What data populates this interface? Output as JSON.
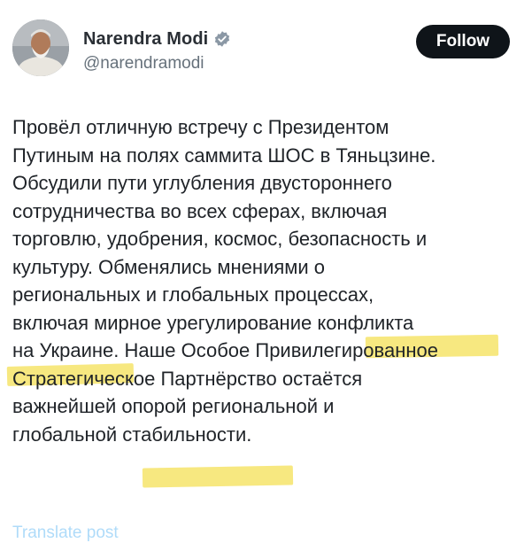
{
  "user": {
    "display_name": "Narendra Modi",
    "handle": "@narendramodi",
    "verified_color": "#8b98a5"
  },
  "actions": {
    "follow_label": "Follow"
  },
  "tweet": {
    "text": "Провёл отличную встречу с Президентом\nПутиным на полях саммита ШОС в Тяньцзине.\nОбсудили пути углубления двустороннего\nсотрудничества во всех сферах, включая\nторговлю, удобрения, космос, безопасность и\nкультуру. Обменялись мнениями о\nрегиональных и глобальных процессах,\nвключая мирное урегулирование конфликта\nна Украине. Наше Особое Привилегированное\nСтратегическое Партнёрство остаётся\nважнейшей опорой региональной и\nглобальной стабильности.",
    "highlight_color": "#f6e46a"
  },
  "footer": {
    "translate_label": "Translate post"
  }
}
